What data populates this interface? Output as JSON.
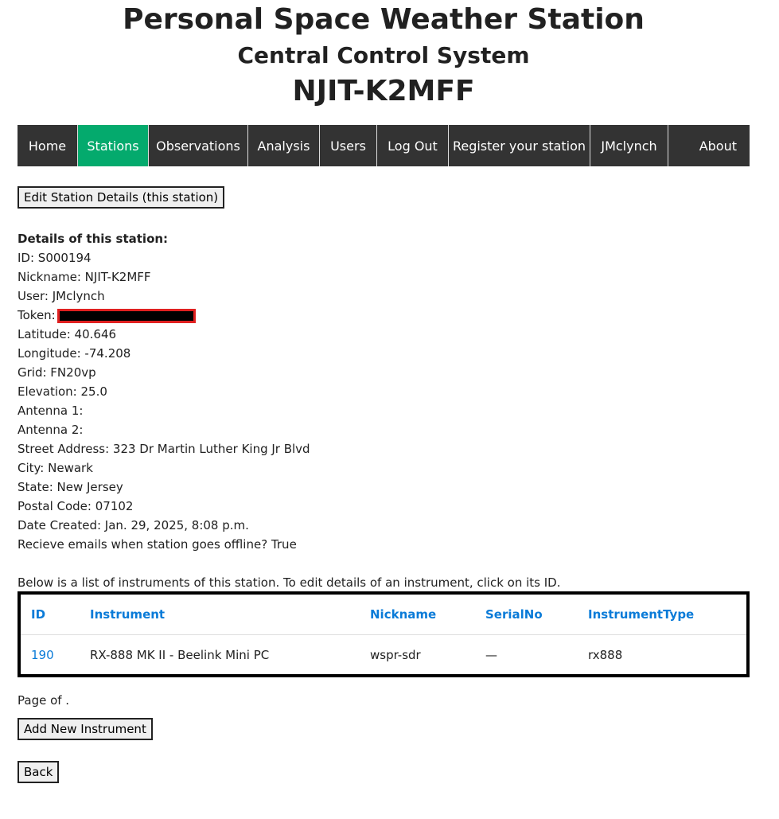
{
  "header": {
    "title": "Personal Space Weather Station",
    "subtitle": "Central Control System",
    "station_name": "NJIT-K2MFF"
  },
  "nav": {
    "items": [
      {
        "label": "Home"
      },
      {
        "label": "Stations"
      },
      {
        "label": "Observations"
      },
      {
        "label": "Analysis"
      },
      {
        "label": "Users"
      },
      {
        "label": "Log Out"
      },
      {
        "label": "Register your station"
      },
      {
        "label": "JMclynch"
      },
      {
        "label": "About"
      }
    ],
    "active": "Stations",
    "bar_color": "#333333",
    "active_color": "#04AA6D"
  },
  "buttons": {
    "edit_station": "Edit Station Details (this station)",
    "add_instrument": "Add New Instrument",
    "back": "Back"
  },
  "details": {
    "heading": "Details of this station:",
    "id": "ID: S000194",
    "nickname": "Nickname: NJIT-K2MFF",
    "user": "User: JMclynch",
    "token_label": "Token:",
    "latitude": "Latitude: 40.646",
    "longitude": "Longitude: -74.208",
    "grid": "Grid: FN20vp",
    "elevation": "Elevation: 25.0",
    "antenna1": "Antenna 1:",
    "antenna2": "Antenna 2:",
    "street": "Street Address: 323 Dr Martin Luther King Jr Blvd",
    "city": "City: Newark",
    "state": "State: New Jersey",
    "postal": "Postal Code: 07102",
    "date_created": "Date Created: Jan. 29, 2025, 8:08 p.m.",
    "emails": "Recieve emails when station goes offline? True"
  },
  "instruments": {
    "intro": "Below is a list of instruments of this station. To edit details of an instrument, click on its ID.",
    "columns": [
      "ID",
      "Instrument",
      "Nickname",
      "SerialNo",
      "InstrumentType"
    ],
    "rows": [
      [
        "190",
        "RX-888 MK II - Beelink Mini PC",
        "wspr-sdr",
        "—",
        "rx888"
      ]
    ],
    "link_color": "#0a7bd8"
  },
  "pager": {
    "text": "Page of ."
  }
}
